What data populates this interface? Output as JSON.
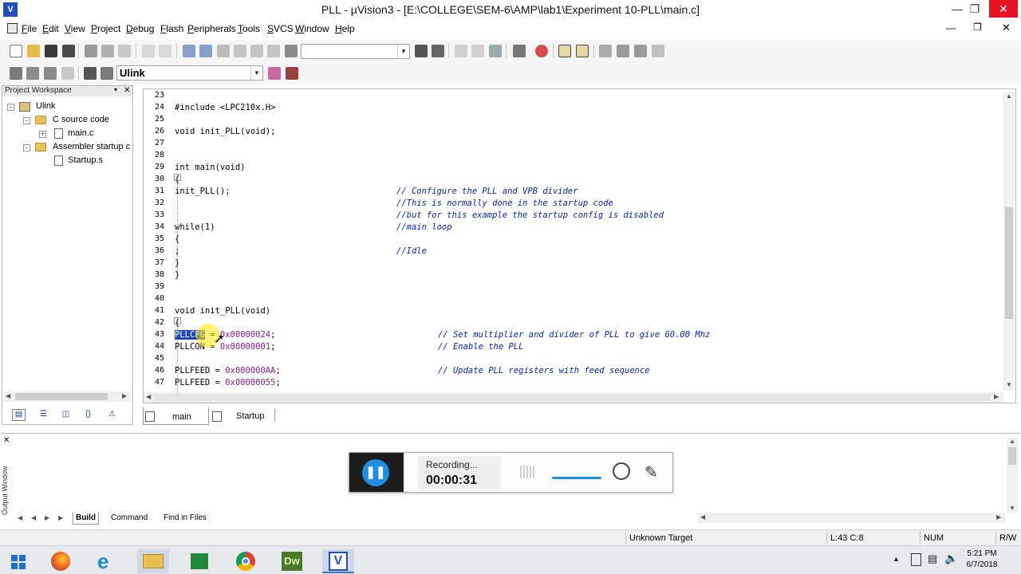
{
  "window": {
    "title": "PLL  -  µVision3 - [E:\\COLLEGE\\SEM-6\\AMP\\lab1\\Experiment 10-PLL\\main.c]"
  },
  "menu": [
    {
      "label": "File"
    },
    {
      "label": "Edit"
    },
    {
      "label": "View"
    },
    {
      "label": "Project"
    },
    {
      "label": "Debug"
    },
    {
      "label": "Flash"
    },
    {
      "label": "Peripherals"
    },
    {
      "label": "Tools"
    },
    {
      "label": "SVCS"
    },
    {
      "label": "Window"
    },
    {
      "label": "Help"
    }
  ],
  "toolbar2": {
    "target_value": "Ulink"
  },
  "project": {
    "header": "Project Workspace",
    "root": "Ulink",
    "groups": [
      {
        "label": "C source code",
        "files": [
          "main.c"
        ]
      },
      {
        "label": "Assembler startup c",
        "files": [
          "Startup.s"
        ]
      }
    ]
  },
  "editor": {
    "lines": [
      {
        "n": "23",
        "code": "",
        "comment": ""
      },
      {
        "n": "24",
        "code": "#include <LPC210x.H>",
        "comment": ""
      },
      {
        "n": "25",
        "code": "",
        "comment": ""
      },
      {
        "n": "26",
        "code": "void init_PLL(void);",
        "comment": ""
      },
      {
        "n": "27",
        "code": "",
        "comment": ""
      },
      {
        "n": "28",
        "code": "",
        "comment": ""
      },
      {
        "n": "29",
        "code": "int main(void)",
        "comment": ""
      },
      {
        "n": "30",
        "code": "{",
        "comment": ""
      },
      {
        "n": "31",
        "code": "init_PLL();",
        "comment": "// Configure the PLL and VPB divider"
      },
      {
        "n": "32",
        "code": "",
        "comment": "//This is normally done in the startup code"
      },
      {
        "n": "33",
        "code": "",
        "comment": "//but for this example the startup config is disabled"
      },
      {
        "n": "34",
        "code": "while(1)",
        "comment": "//main loop"
      },
      {
        "n": "35",
        "code": "{",
        "comment": ""
      },
      {
        "n": "36",
        "code": ";",
        "comment": "//Idle"
      },
      {
        "n": "37",
        "code": "}",
        "comment": ""
      },
      {
        "n": "38",
        "code": "}",
        "comment": ""
      },
      {
        "n": "39",
        "code": "",
        "comment": ""
      },
      {
        "n": "40",
        "code": "",
        "comment": ""
      },
      {
        "n": "41",
        "code": "void init_PLL(void)",
        "comment": ""
      },
      {
        "n": "42",
        "code": "{",
        "comment": ""
      },
      {
        "n": "43",
        "sel": "PLLCFG",
        "rest": " = ",
        "num": "0x00000024",
        "end": ";",
        "comment": "// Set multiplier and divider of PLL to give 60.00 Mhz"
      },
      {
        "n": "44",
        "sel": "",
        "rest": "PLLCON = ",
        "num": "0x00000001",
        "end": ";",
        "comment": "// Enable the PLL"
      },
      {
        "n": "45",
        "code": "",
        "comment": ""
      },
      {
        "n": "46",
        "sel": "",
        "rest": "PLLFEED = ",
        "num": "0x000000AA",
        "end": ";",
        "comment": "// Update PLL registers with feed sequence"
      },
      {
        "n": "47",
        "sel": "",
        "rest": "PLLFEED = ",
        "num": "0x00000055",
        "end": ";",
        "comment": ""
      }
    ]
  },
  "file_tabs": [
    "main",
    "Startup"
  ],
  "output_window": {
    "side_label": "Output Window",
    "tabs": [
      "Build",
      "Command",
      "Find in Files"
    ]
  },
  "recording": {
    "status": "Recording...",
    "time": "00:00:31"
  },
  "statusbar": {
    "target": "Unknown Target",
    "cursor": "L:43 C:8",
    "num": "NUM",
    "rw": "R/W"
  },
  "taskbar": {
    "time": "5:21 PM",
    "date": "6/7/2018"
  },
  "colors": {
    "selection": "#1e49b7",
    "comment": "#0a24b3",
    "number": "#8a1ea0",
    "record_button": "#1e8fe2",
    "close_button": "#e81123"
  }
}
